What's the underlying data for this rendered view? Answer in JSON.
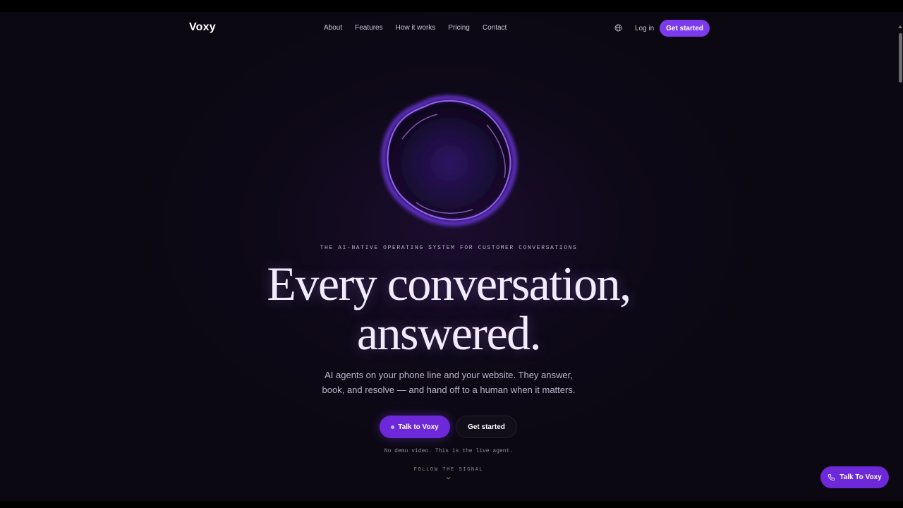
{
  "nav": {
    "logo": "Voxy",
    "links": [
      "About",
      "Features",
      "How it works",
      "Pricing",
      "Contact"
    ],
    "login": "Log in",
    "cta": "Get started"
  },
  "hero": {
    "eyebrow": "THE AI-NATIVE OPERATING SYSTEM FOR CUSTOMER CONVERSATIONS",
    "headline_line1": "Every conversation,",
    "headline_line2": "answered.",
    "subtext_line1": "AI agents on your phone line and your website. They answer,",
    "subtext_line2": "book, and resolve — and hand off to a human when it matters.",
    "primary_button": "Talk to Voxy",
    "secondary_button": "Get started",
    "note": "No demo video. This is the live agent.",
    "follow": "FOLLOW THE SIGNAL"
  },
  "floating": {
    "label": "Talk To Voxy"
  },
  "colors": {
    "accent": "#7c3aed",
    "background": "#0b0812"
  }
}
